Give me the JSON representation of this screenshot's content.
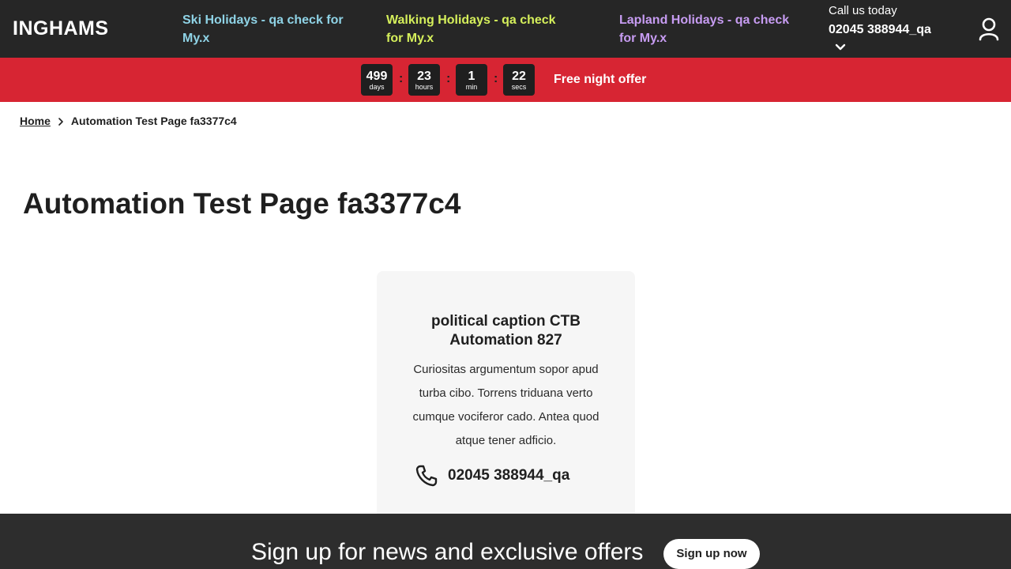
{
  "header": {
    "logo": "INGHAMS",
    "nav": [
      {
        "label": "Ski Holidays - qa check for My.x"
      },
      {
        "label": "Walking Holidays - qa check for My.x"
      },
      {
        "label": "Lapland Holidays - qa check for My.x"
      }
    ],
    "call_label": "Call us today",
    "call_number": "02045 388944_qa"
  },
  "countdown": {
    "items": [
      {
        "value": "499",
        "unit": "days"
      },
      {
        "value": "23",
        "unit": "hours"
      },
      {
        "value": "1",
        "unit": "min"
      },
      {
        "value": "22",
        "unit": "secs"
      }
    ],
    "separator": ":",
    "offer_label": "Free night offer"
  },
  "breadcrumb": {
    "home": "Home",
    "current": "Automation Test Page fa3377c4"
  },
  "page_title": "Automation Test Page fa3377c4",
  "card": {
    "title": "political caption CTB Automation 827",
    "body": "Curiositas argumentum sopor apud turba cibo. Torrens triduana verto cumque vociferor cado. Antea quod atque tener adficio.",
    "phone": "02045 388944_qa"
  },
  "signup": {
    "text": "Sign up for news and exclusive offers",
    "button": "Sign up now"
  },
  "colors": {
    "header_bg": "#262626",
    "banner_bg": "#d72533",
    "ski": "#8fd3e6",
    "walking": "#d5ef5b",
    "lapland": "#c79cf2"
  }
}
